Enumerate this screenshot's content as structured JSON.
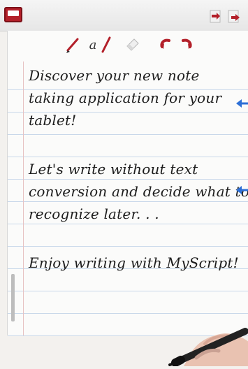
{
  "header": {
    "app_icon": "notebook-icon",
    "right_icons": [
      "export-icon",
      "share-icon"
    ]
  },
  "toolbar": {
    "tools": [
      {
        "name": "pen-tool-icon"
      },
      {
        "name": "eraser-tool-icon"
      },
      {
        "name": "undo-icon"
      },
      {
        "name": "redo-icon"
      }
    ],
    "text_format_label": "a"
  },
  "note": {
    "paragraphs": [
      [
        "Discover your new note",
        "taking application for your",
        "tablet!"
      ],
      [
        "Let's write without text",
        "conversion and decide what to",
        "recognize later. . ."
      ],
      [
        "Enjoy writing with MyScript!"
      ]
    ]
  },
  "colors": {
    "accent": "#b3202a",
    "ruled_line": "#c9d8ea",
    "arrow": "#2d6fd6"
  }
}
